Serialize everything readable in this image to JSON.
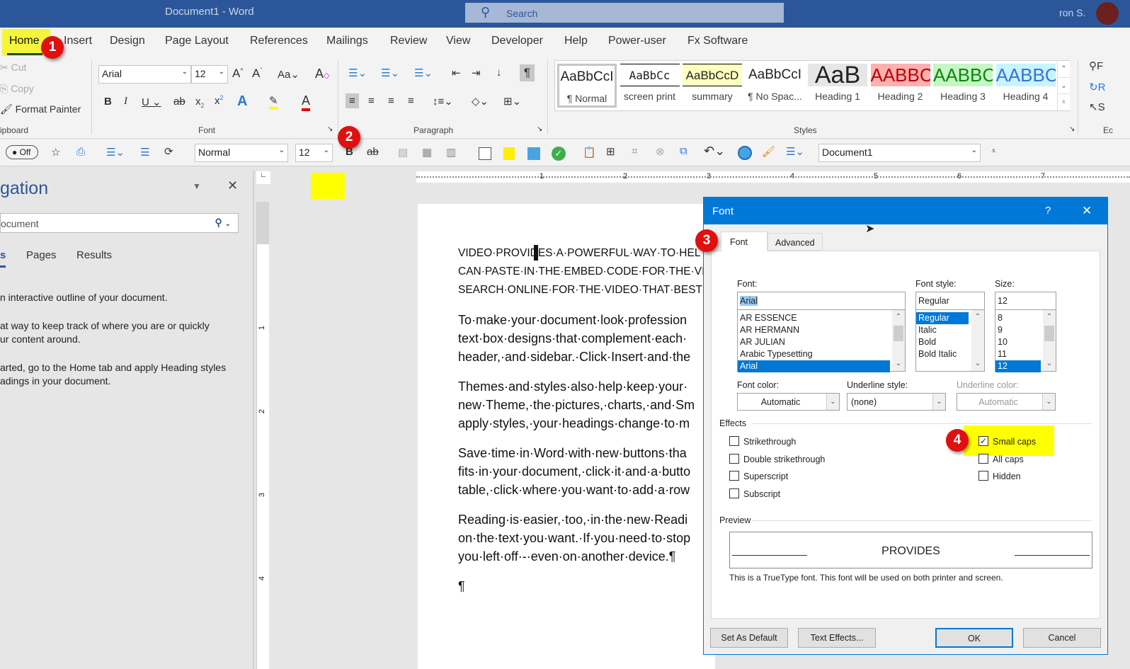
{
  "titlebar": {
    "title": "Document1  -  Word",
    "search_placeholder": "Search",
    "user": "ron S."
  },
  "menu": {
    "tabs": [
      "Home",
      "Insert",
      "Design",
      "Page Layout",
      "References",
      "Mailings",
      "Review",
      "View",
      "Developer",
      "Help",
      "Power-user",
      "Fx Software"
    ]
  },
  "ribbon": {
    "clipboard": {
      "cut": "Cut",
      "copy": "Copy",
      "format_painter": "Format Painter",
      "label": "ipboard"
    },
    "font": {
      "name": "Arial",
      "size": "12",
      "label": "Font"
    },
    "paragraph": {
      "label": "Paragraph"
    },
    "styles": {
      "label": "Styles",
      "items": [
        {
          "preview": "AaBbCcI",
          "name": "¶ Normal"
        },
        {
          "preview": "AaBbCc",
          "name": "screen print"
        },
        {
          "preview": "AaBbCcD",
          "name": "summary"
        },
        {
          "preview": "AaBbCcI",
          "name": "¶ No Spac..."
        },
        {
          "preview": "AaB",
          "name": "Heading 1"
        },
        {
          "preview": "AABBC",
          "name": "Heading 2"
        },
        {
          "preview": "AABBC",
          "name": "Heading 3"
        },
        {
          "preview": "AABBC",
          "name": "Heading 4"
        }
      ]
    },
    "editing": {
      "label": "Ec"
    }
  },
  "qat": {
    "toggle": "Off",
    "style": "Normal",
    "size": "12",
    "document": "Document1"
  },
  "badges": [
    "1",
    "2",
    "3",
    "4"
  ],
  "nav": {
    "title": "gation",
    "search_placeholder": "ocument",
    "tabs": [
      "s",
      "Pages",
      "Results"
    ],
    "lines": [
      "n interactive outline of your document.",
      "at way to keep track of where you are or quickly",
      "ur content around.",
      "arted, go to the Home tab and apply Heading styles",
      "adings in your document."
    ]
  },
  "ruler": {
    "marks": [
      "1",
      "2",
      "3",
      "4",
      "5",
      "6",
      "7"
    ],
    "vmarks": [
      "1",
      "2",
      "3",
      "4"
    ]
  },
  "document": {
    "paragraphs": [
      [
        "VIDEO·PROVIDES·A·POWERFUL·WAY·TO·HEL",
        "CAN·PASTE·IN·THE·EMBED·CODE·FOR·THE·VI",
        "SEARCH·ONLINE·FOR·THE·VIDEO·THAT·BEST·"
      ],
      [
        "To·make·your·document·look·profession",
        "text·box·designs·that·complement·each·",
        "header,·and·sidebar.·Click·Insert·and·the"
      ],
      [
        "Themes·and·styles·also·help·keep·your·",
        "new·Theme,·the·pictures,·charts,·and·Sm",
        "apply·styles,·your·headings·change·to·m"
      ],
      [
        "Save·time·in·Word·with·new·buttons·tha",
        "fits·in·your·document,·click·it·and·a·butto",
        "table,·click·where·you·want·to·add·a·row"
      ],
      [
        "Reading·is·easier,·too,·in·the·new·Readi",
        "on·the·text·you·want.·If·you·need·to·stop",
        "you·left·off·-·even·on·another·device.¶"
      ],
      [
        "¶"
      ]
    ]
  },
  "dialog": {
    "title": "Font",
    "help": "?",
    "tabs": [
      "Font",
      "Advanced"
    ],
    "font_label": "Font:",
    "font_value": "Arial",
    "fonts": [
      "AR ESSENCE",
      "AR HERMANN",
      "AR JULIAN",
      "Arabic Typesetting",
      "Arial"
    ],
    "style_label": "Font style:",
    "style_value": "Regular",
    "styles": [
      "Regular",
      "Italic",
      "Bold",
      "Bold Italic"
    ],
    "size_label": "Size:",
    "size_value": "12",
    "sizes": [
      "8",
      "9",
      "10",
      "11",
      "12"
    ],
    "font_color_label": "Font color:",
    "font_color": "Automatic",
    "underline_style_label": "Underline style:",
    "underline_style": "(none)",
    "underline_color_label": "Underline color:",
    "underline_color": "Automatic",
    "effects_label": "Effects",
    "effects_left": [
      {
        "label": "Strikethrough",
        "checked": false
      },
      {
        "label": "Double strikethrough",
        "checked": false
      },
      {
        "label": "Superscript",
        "checked": false
      },
      {
        "label": "Subscript",
        "checked": false
      }
    ],
    "effects_right": [
      {
        "label": "Small caps",
        "checked": true
      },
      {
        "label": "All caps",
        "checked": false
      },
      {
        "label": "Hidden",
        "checked": false
      }
    ],
    "preview_label": "Preview",
    "preview_text": "PROVIDES",
    "note": "This is a TrueType font. This font will be used on both printer and screen.",
    "buttons": {
      "default": "Set As Default",
      "effects": "Text Effects...",
      "ok": "OK",
      "cancel": "Cancel"
    }
  },
  "colors": {
    "title_blue": "#2b579a",
    "dialog_blue": "#0078d7",
    "highlight": "#ffff00",
    "badge_red": "#e01010"
  }
}
